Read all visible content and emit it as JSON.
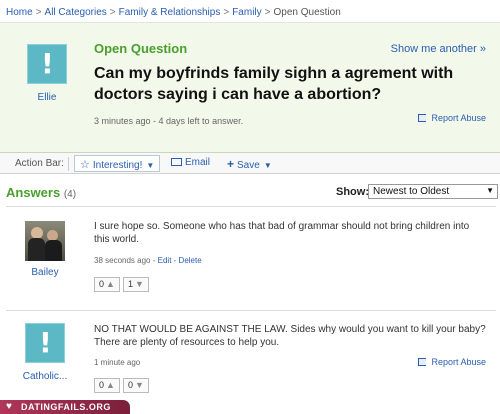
{
  "breadcrumb": {
    "items": [
      "Home",
      "All Categories",
      "Family & Relationships",
      "Family"
    ],
    "separator": ">",
    "current": "Open Question"
  },
  "question": {
    "label": "Open Question",
    "show_more": "Show me another »",
    "title": "Can my boyfrinds family sighn a agrement with doctors saying i can have a abortion?",
    "meta": "3 minutes ago - 4 days left to answer.",
    "asker": "Ellie",
    "report": "Report Abuse"
  },
  "action_bar": {
    "label": "Action Bar:",
    "interesting": "Interesting!",
    "email": "Email",
    "save": "Save"
  },
  "answers": {
    "heading": "Answers",
    "count": "(4)",
    "show_label": "Show:",
    "sort_value": "Newest to Oldest",
    "items": [
      {
        "user": "Bailey",
        "text": "I sure hope so. Someone who has that bad of grammar should not bring children into this world.",
        "time": "38 seconds ago",
        "edit": "Edit",
        "delete": "Delete",
        "thumbs_up": "0",
        "thumbs_down": "1"
      },
      {
        "user": "Catholic...",
        "text": "NO THAT WOULD BE AGAINST THE LAW. Sides why would you want to kill your baby? There are plenty of resources to help you.",
        "time": "1 minute ago",
        "report": "Report Abuse",
        "thumbs_up": "0",
        "thumbs_down": "0"
      }
    ]
  },
  "watermark": "DATINGFAILS.ORG",
  "colors": {
    "accent_green": "#4aa02c",
    "link_blue": "#2a5db0",
    "question_bg": "#f2f9ea",
    "avatar_teal": "#5bb8c4",
    "watermark": "#b0365a"
  }
}
